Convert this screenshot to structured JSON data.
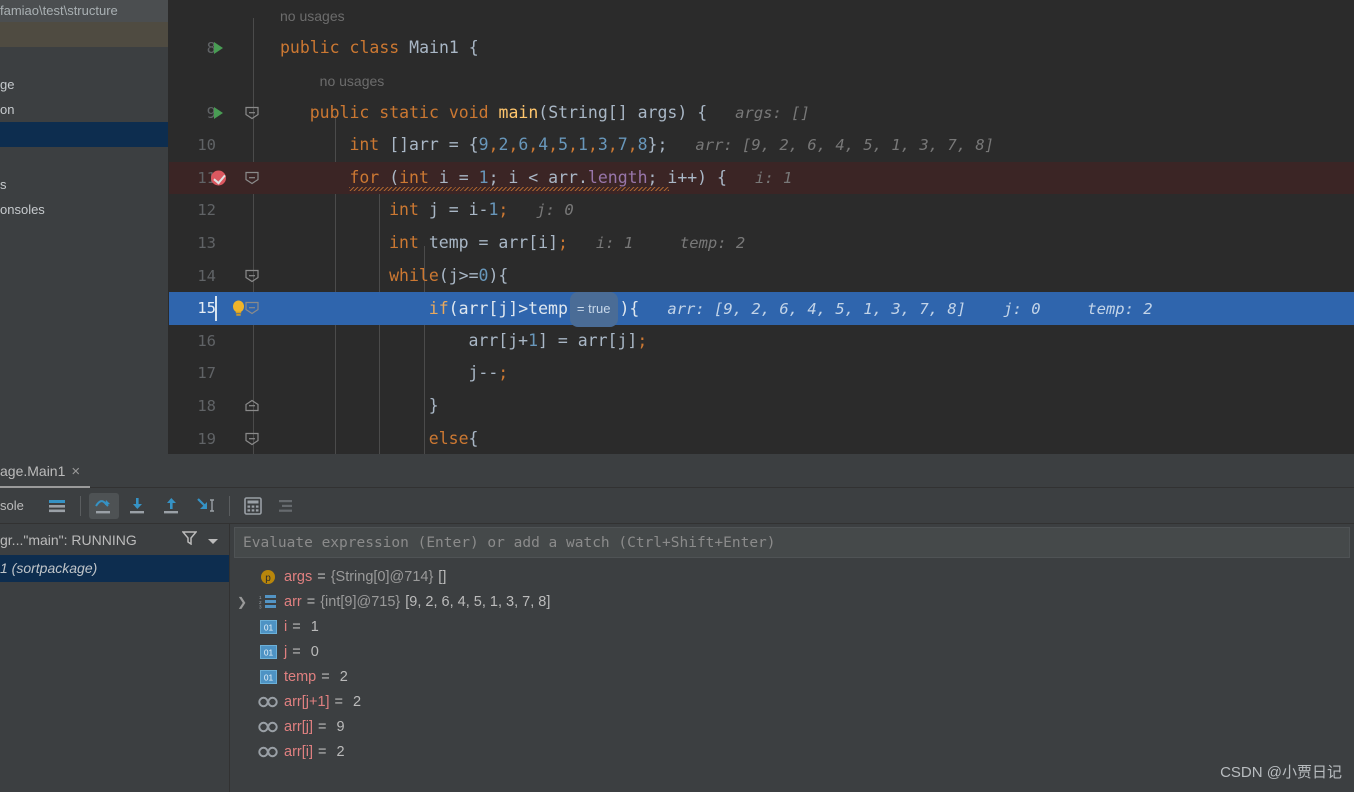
{
  "project_pane": {
    "path_label": "famiao\\test\\structure",
    "rows": [
      {
        "label": "",
        "state": "selected-brown"
      },
      {
        "label": "",
        "state": "normal"
      },
      {
        "label": "ge",
        "state": "normal"
      },
      {
        "label": "on",
        "state": "normal"
      },
      {
        "label": "",
        "state": "selected-blue"
      },
      {
        "label": "",
        "state": "normal"
      },
      {
        "label": "s",
        "state": "normal"
      },
      {
        "label": "onsoles",
        "state": "normal"
      }
    ]
  },
  "editor": {
    "hint_no_usages": "no usages",
    "lines": [
      {
        "number": "8",
        "run_marker": true,
        "fold": false,
        "tokens": [
          {
            "t": "public ",
            "c": "kw"
          },
          {
            "t": "class ",
            "c": "kw"
          },
          {
            "t": "Main1 {",
            "c": "plain"
          }
        ],
        "inline": ""
      },
      {
        "number": "9",
        "run_marker": true,
        "fold": true,
        "tokens": [
          {
            "t": "public ",
            "c": "kw"
          },
          {
            "t": "static ",
            "c": "kw"
          },
          {
            "t": "void ",
            "c": "kw"
          },
          {
            "t": "main",
            "c": "fn"
          },
          {
            "t": "(String[] args) {",
            "c": "plain"
          }
        ],
        "inline": "args: []"
      },
      {
        "number": "10",
        "run_marker": false,
        "fold": false,
        "tokens": [
          {
            "t": "int ",
            "c": "kw"
          },
          {
            "t": "[]arr = {",
            "c": "plain"
          },
          {
            "t": "9",
            "c": "num"
          },
          {
            "t": ",",
            "c": "kw"
          },
          {
            "t": "2",
            "c": "num"
          },
          {
            "t": ",",
            "c": "kw"
          },
          {
            "t": "6",
            "c": "num"
          },
          {
            "t": ",",
            "c": "kw"
          },
          {
            "t": "4",
            "c": "num"
          },
          {
            "t": ",",
            "c": "kw"
          },
          {
            "t": "5",
            "c": "num"
          },
          {
            "t": ",",
            "c": "kw"
          },
          {
            "t": "1",
            "c": "num"
          },
          {
            "t": ",",
            "c": "kw"
          },
          {
            "t": "3",
            "c": "num"
          },
          {
            "t": ",",
            "c": "kw"
          },
          {
            "t": "7",
            "c": "num"
          },
          {
            "t": ",",
            "c": "kw"
          },
          {
            "t": "8",
            "c": "num"
          },
          {
            "t": "};",
            "c": "plain"
          }
        ],
        "inline": "arr: [9, 2, 6, 4, 5, 1, 3, 7, 8]"
      },
      {
        "number": "11",
        "run_marker": false,
        "breakpoint": true,
        "fold": true,
        "highlight": "breakpoint",
        "tokens": [
          {
            "t": "for ",
            "c": "kw"
          },
          {
            "t": "(",
            "c": "plain"
          },
          {
            "t": "int ",
            "c": "kw"
          },
          {
            "t": "i = ",
            "c": "plain"
          },
          {
            "t": "1",
            "c": "num"
          },
          {
            "t": "; i < arr.",
            "c": "plain"
          },
          {
            "t": "length",
            "c": "fld"
          },
          {
            "t": "; i++) {",
            "c": "plain"
          }
        ],
        "inline": "i: 1"
      },
      {
        "number": "12",
        "run_marker": false,
        "fold": false,
        "tokens": [
          {
            "t": "int ",
            "c": "kw"
          },
          {
            "t": "j = i-",
            "c": "plain"
          },
          {
            "t": "1",
            "c": "num"
          },
          {
            "t": ";",
            "c": "kw"
          }
        ],
        "inline": "j: 0"
      },
      {
        "number": "13",
        "run_marker": false,
        "fold": false,
        "tokens": [
          {
            "t": "int ",
            "c": "kw"
          },
          {
            "t": "temp = arr[i]",
            "c": "plain"
          },
          {
            "t": ";",
            "c": "kw"
          }
        ],
        "inline": "i: 1     temp: 2"
      },
      {
        "number": "14",
        "run_marker": false,
        "fold": true,
        "tokens": [
          {
            "t": "while",
            "c": "kw"
          },
          {
            "t": "(j>=",
            "c": "plain"
          },
          {
            "t": "0",
            "c": "num"
          },
          {
            "t": "){",
            "c": "plain"
          }
        ],
        "inline": ""
      },
      {
        "number": "15",
        "run_marker": false,
        "fold": true,
        "highlight": "selected",
        "bulb": true,
        "caret": true,
        "tokens": [
          {
            "t": "if",
            "c": "kw"
          },
          {
            "t": "(arr[j]>temp",
            "c": "plain"
          },
          {
            "t": "= true",
            "c": "badge"
          },
          {
            "t": "){",
            "c": "plain"
          }
        ],
        "inline": "arr: [9, 2, 6, 4, 5, 1, 3, 7, 8]    j: 0     temp: 2"
      },
      {
        "number": "16",
        "run_marker": false,
        "fold": false,
        "tokens": [
          {
            "t": "arr[j+",
            "c": "plain"
          },
          {
            "t": "1",
            "c": "num"
          },
          {
            "t": "] = arr[j]",
            "c": "plain"
          },
          {
            "t": ";",
            "c": "kw"
          }
        ],
        "inline": ""
      },
      {
        "number": "17",
        "run_marker": false,
        "fold": false,
        "tokens": [
          {
            "t": "j--",
            "c": "plain"
          },
          {
            "t": ";",
            "c": "kw"
          }
        ],
        "inline": ""
      },
      {
        "number": "18",
        "run_marker": false,
        "fold": true,
        "tokens": [
          {
            "t": "}",
            "c": "plain"
          }
        ],
        "inline": ""
      },
      {
        "number": "19",
        "run_marker": false,
        "fold": true,
        "tokens": [
          {
            "t": "else",
            "c": "kw"
          },
          {
            "t": "{",
            "c": "plain"
          }
        ],
        "inline": ""
      }
    ]
  },
  "debug": {
    "tab_label": "age.Main1",
    "tab_close": "×",
    "console_label": "sole",
    "toolbar_buttons": [
      {
        "name": "show-execution-point-icon",
        "active": false
      },
      {
        "name": "step-over-icon",
        "active": true
      },
      {
        "name": "step-into-icon",
        "active": false
      },
      {
        "name": "step-out-icon",
        "active": false
      },
      {
        "name": "run-to-cursor-icon",
        "active": false
      },
      {
        "name": "evaluate-expression-icon",
        "active": false
      },
      {
        "name": "mute-breakpoints-icon",
        "active": false
      }
    ],
    "frames": {
      "thread_label": "gr...\"main\": RUNNING",
      "filter_icon": "filter-icon",
      "dropdown_icon": "chevron-down-icon",
      "rows": [
        {
          "label": "1 (sortpackage)",
          "selected": true
        }
      ]
    },
    "evaluate_placeholder": "Evaluate expression (Enter) or add a watch (Ctrl+Shift+Enter)",
    "variables": [
      {
        "icon": "parameter-icon",
        "expandable": false,
        "name": "args",
        "ref": "{String[0]@714}",
        "value": "[]"
      },
      {
        "icon": "array-icon",
        "expandable": true,
        "name": "arr",
        "ref": "{int[9]@715}",
        "value": "[9, 2, 6, 4, 5, 1, 3, 7, 8]"
      },
      {
        "icon": "primitive-icon",
        "expandable": false,
        "name": "i",
        "ref": "",
        "value": "1"
      },
      {
        "icon": "primitive-icon",
        "expandable": false,
        "name": "j",
        "ref": "",
        "value": "0"
      },
      {
        "icon": "primitive-icon",
        "expandable": false,
        "name": "temp",
        "ref": "",
        "value": "2"
      },
      {
        "icon": "watch-icon",
        "expandable": false,
        "name": "arr[j+1]",
        "ref": "",
        "value": "2"
      },
      {
        "icon": "watch-icon",
        "expandable": false,
        "name": "arr[j]",
        "ref": "",
        "value": "9"
      },
      {
        "icon": "watch-icon",
        "expandable": false,
        "name": "arr[i]",
        "ref": "",
        "value": "2"
      }
    ]
  },
  "watermark": "CSDN @小贾日记",
  "colors": {
    "editor_bg": "#2b2b2b",
    "panel_bg": "#3c3f41",
    "keyword": "#cc7832",
    "number": "#6897bb",
    "method": "#ffc66d",
    "field": "#9876aa",
    "text": "#a9b7c6",
    "selection": "#2f65ad",
    "breakpoint_line": "#3b2525",
    "breakpoint": "#db5860",
    "run_marker": "#499c54",
    "var_name": "#e08080"
  }
}
